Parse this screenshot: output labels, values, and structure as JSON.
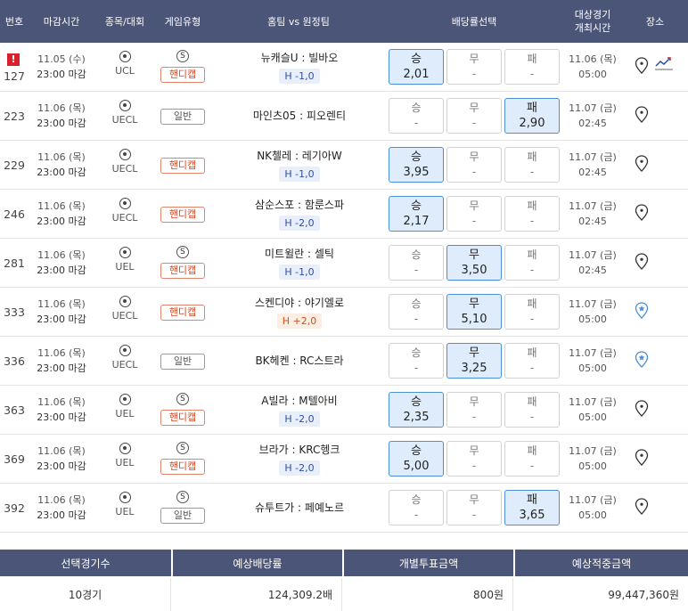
{
  "header": {
    "num": "번호",
    "deadline": "마감시간",
    "sport": "종목/대회",
    "game_type": "게임유형",
    "teams": "홈팀 vs 원정팀",
    "odds_select": "배당률선택",
    "target_time_1": "대상경기",
    "target_time_2": "개최시간",
    "location": "장소"
  },
  "rows": [
    {
      "num": "127",
      "flag": "!",
      "d1": "11.05 (수)",
      "d2": "23:00 마감",
      "league": "UCL",
      "s_badge": "S",
      "type": "핸디캡",
      "teams": "뉴캐슬U : 빌바오",
      "handi": "H -1,0",
      "win_l": "승",
      "win_v": "2,01",
      "draw_l": "무",
      "draw_v": "-",
      "lose_l": "패",
      "lose_v": "-",
      "t1": "11.06 (목)",
      "t2": "05:00"
    },
    {
      "num": "223",
      "d1": "11.06 (목)",
      "d2": "23:00 마감",
      "league": "UECL",
      "type": "일반",
      "teams": "마인츠05 : 피오렌티",
      "win_l": "승",
      "win_v": "-",
      "draw_l": "무",
      "draw_v": "-",
      "lose_l": "패",
      "lose_v": "2,90",
      "t1": "11.07 (금)",
      "t2": "02:45"
    },
    {
      "num": "229",
      "d1": "11.06 (목)",
      "d2": "23:00 마감",
      "league": "UECL",
      "type": "핸디캡",
      "teams": "NK첼레 : 레기아W",
      "handi": "H -1,0",
      "win_l": "승",
      "win_v": "3,95",
      "draw_l": "무",
      "draw_v": "-",
      "lose_l": "패",
      "lose_v": "-",
      "t1": "11.07 (금)",
      "t2": "02:45"
    },
    {
      "num": "246",
      "d1": "11.06 (목)",
      "d2": "23:00 마감",
      "league": "UECL",
      "type": "핸디캡",
      "teams": "삼순스포 : 함룬스파",
      "handi": "H -2,0",
      "win_l": "승",
      "win_v": "2,17",
      "draw_l": "무",
      "draw_v": "-",
      "lose_l": "패",
      "lose_v": "-",
      "t1": "11.07 (금)",
      "t2": "02:45"
    },
    {
      "num": "281",
      "d1": "11.06 (목)",
      "d2": "23:00 마감",
      "league": "UEL",
      "s_badge": "S",
      "type": "핸디캡",
      "teams": "미트윌란 : 셀틱",
      "handi": "H -1,0",
      "win_l": "승",
      "win_v": "-",
      "draw_l": "무",
      "draw_v": "3,50",
      "lose_l": "패",
      "lose_v": "-",
      "t1": "11.07 (금)",
      "t2": "02:45"
    },
    {
      "num": "333",
      "d1": "11.06 (목)",
      "d2": "23:00 마감",
      "league": "UECL",
      "type": "핸디캡",
      "teams": "스켄디야 : 야기엘로",
      "handi": "H +2,0",
      "win_l": "승",
      "win_v": "-",
      "draw_l": "무",
      "draw_v": "5,10",
      "lose_l": "패",
      "lose_v": "-",
      "t1": "11.07 (금)",
      "t2": "05:00"
    },
    {
      "num": "336",
      "d1": "11.06 (목)",
      "d2": "23:00 마감",
      "league": "UECL",
      "type": "일반",
      "teams": "BK헤켄 : RC스트라",
      "win_l": "승",
      "win_v": "-",
      "draw_l": "무",
      "draw_v": "3,25",
      "lose_l": "패",
      "lose_v": "-",
      "t1": "11.07 (금)",
      "t2": "05:00"
    },
    {
      "num": "363",
      "d1": "11.06 (목)",
      "d2": "23:00 마감",
      "league": "UEL",
      "s_badge": "S",
      "type": "핸디캡",
      "teams": "A빌라 : M텔아비",
      "handi": "H -2,0",
      "win_l": "승",
      "win_v": "2,35",
      "draw_l": "무",
      "draw_v": "-",
      "lose_l": "패",
      "lose_v": "-",
      "t1": "11.07 (금)",
      "t2": "05:00"
    },
    {
      "num": "369",
      "d1": "11.06 (목)",
      "d2": "23:00 마감",
      "league": "UEL",
      "s_badge": "S",
      "type": "핸디캡",
      "teams": "브라가 : KRC헹크",
      "handi": "H -2,0",
      "win_l": "승",
      "win_v": "5,00",
      "draw_l": "무",
      "draw_v": "-",
      "lose_l": "패",
      "lose_v": "-",
      "t1": "11.07 (금)",
      "t2": "05:00"
    },
    {
      "num": "392",
      "d1": "11.06 (목)",
      "d2": "23:00 마감",
      "league": "UEL",
      "s_badge": "S",
      "type": "일반",
      "teams": "슈투트가 : 페예노르",
      "win_l": "승",
      "win_v": "-",
      "draw_l": "무",
      "draw_v": "-",
      "lose_l": "패",
      "lose_v": "3,65",
      "t1": "11.07 (금)",
      "t2": "05:00"
    }
  ],
  "summary": {
    "h_count": "선택경기수",
    "h_odds": "예상배당률",
    "h_stake": "개별투표금액",
    "h_win": "예상적중금액",
    "count": "10경기",
    "odds": "124,309.2배",
    "stake": "800원",
    "win": "99,447,360원"
  },
  "colors": {
    "header_bg": "#4a5578",
    "selected_bg": "#dfecfb",
    "selected_border": "#4a90d6",
    "handicap_red": "#d24a2a",
    "flag_red": "#d9202c"
  }
}
